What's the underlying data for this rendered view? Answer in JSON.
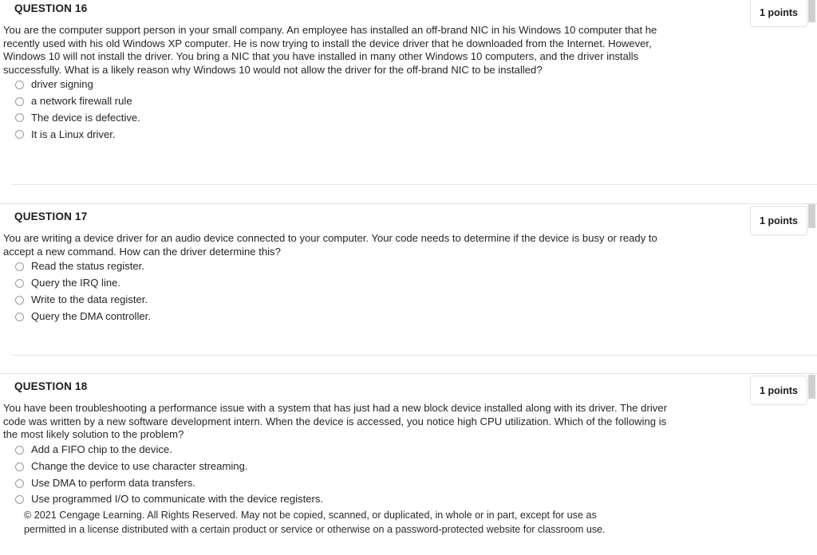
{
  "page": {
    "background": "#ffffff",
    "text_color": "#262626",
    "rule_color": "#e0e0e0",
    "badge_border_color": "#e3e3e3",
    "scrollbar_color": "#cfcfcf"
  },
  "questions": [
    {
      "title": "QUESTION 16",
      "points": "1 points",
      "text": "You are the computer support person in your small company. An employee has installed an off-brand NIC in his Windows 10 computer that he recently used with his old Windows XP computer. He is now trying to install the device driver that he downloaded from the Internet. However, Windows 10 will not install the driver. You bring a NIC that you have installed in many other Windows 10 computers, and the driver installs successfully. What is a likely reason why Windows 10 would not allow the driver for the off-brand NIC to be installed?",
      "options": [
        "driver signing",
        "a network firewall rule",
        "The device is defective.",
        "It is a Linux driver."
      ]
    },
    {
      "title": "QUESTION 17",
      "points": "1 points",
      "text": "You are writing a device driver for an audio device connected to your computer. Your code needs to determine if the device is busy or ready to accept a new command. How can the driver determine this?",
      "options": [
        "Read the status register.",
        "Query the IRQ line.",
        "Write to the data register.",
        "Query the DMA controller."
      ]
    },
    {
      "title": "QUESTION 18",
      "points": "1 points",
      "text": "You have been troubleshooting a performance issue with a system that has just had a new block device installed along with its driver. The driver code was written by a new software development intern. When the device is accessed, you notice high CPU utilization. Which of the following is the most likely solution to the problem?",
      "options": [
        "Add a FIFO chip to the device.",
        "Change the device to use character streaming.",
        "Use DMA to perform data transfers.",
        "Use programmed I/O to communicate with the device registers."
      ]
    }
  ],
  "footer": {
    "copyright_line_1": "© 2021 Cengage Learning. All Rights Reserved. May not be copied, scanned, or duplicated, in whole or in part, except for use as",
    "copyright_line_2": "permitted in a license distributed with a certain product or service or otherwise on a password-protected website for classroom use."
  }
}
